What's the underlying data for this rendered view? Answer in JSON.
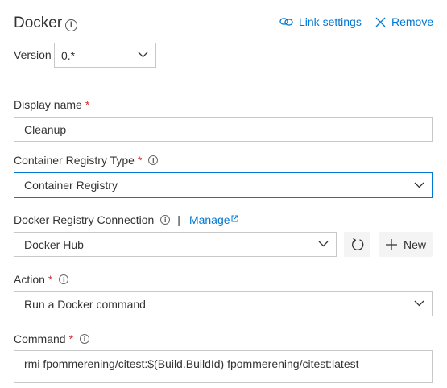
{
  "header": {
    "title": "Docker",
    "link_settings": "Link settings",
    "remove": "Remove"
  },
  "version": {
    "label": "Version",
    "value": "0.*"
  },
  "display_name": {
    "label": "Display name",
    "required": "*",
    "value": "Cleanup"
  },
  "registry_type": {
    "label": "Container Registry Type",
    "required": "*",
    "value": "Container Registry"
  },
  "registry_connection": {
    "label": "Docker Registry Connection",
    "separator": "|",
    "manage": "Manage",
    "value": "Docker Hub",
    "new_label": "New"
  },
  "action": {
    "label": "Action",
    "required": "*",
    "value": "Run a Docker command"
  },
  "command": {
    "label": "Command",
    "required": "*",
    "value": "rmi fpommerening/citest:$(Build.BuildId) fpommerening/citest:latest"
  },
  "colors": {
    "accent": "#0078d4",
    "required": "#d13438",
    "border": "#c8c8c8"
  }
}
